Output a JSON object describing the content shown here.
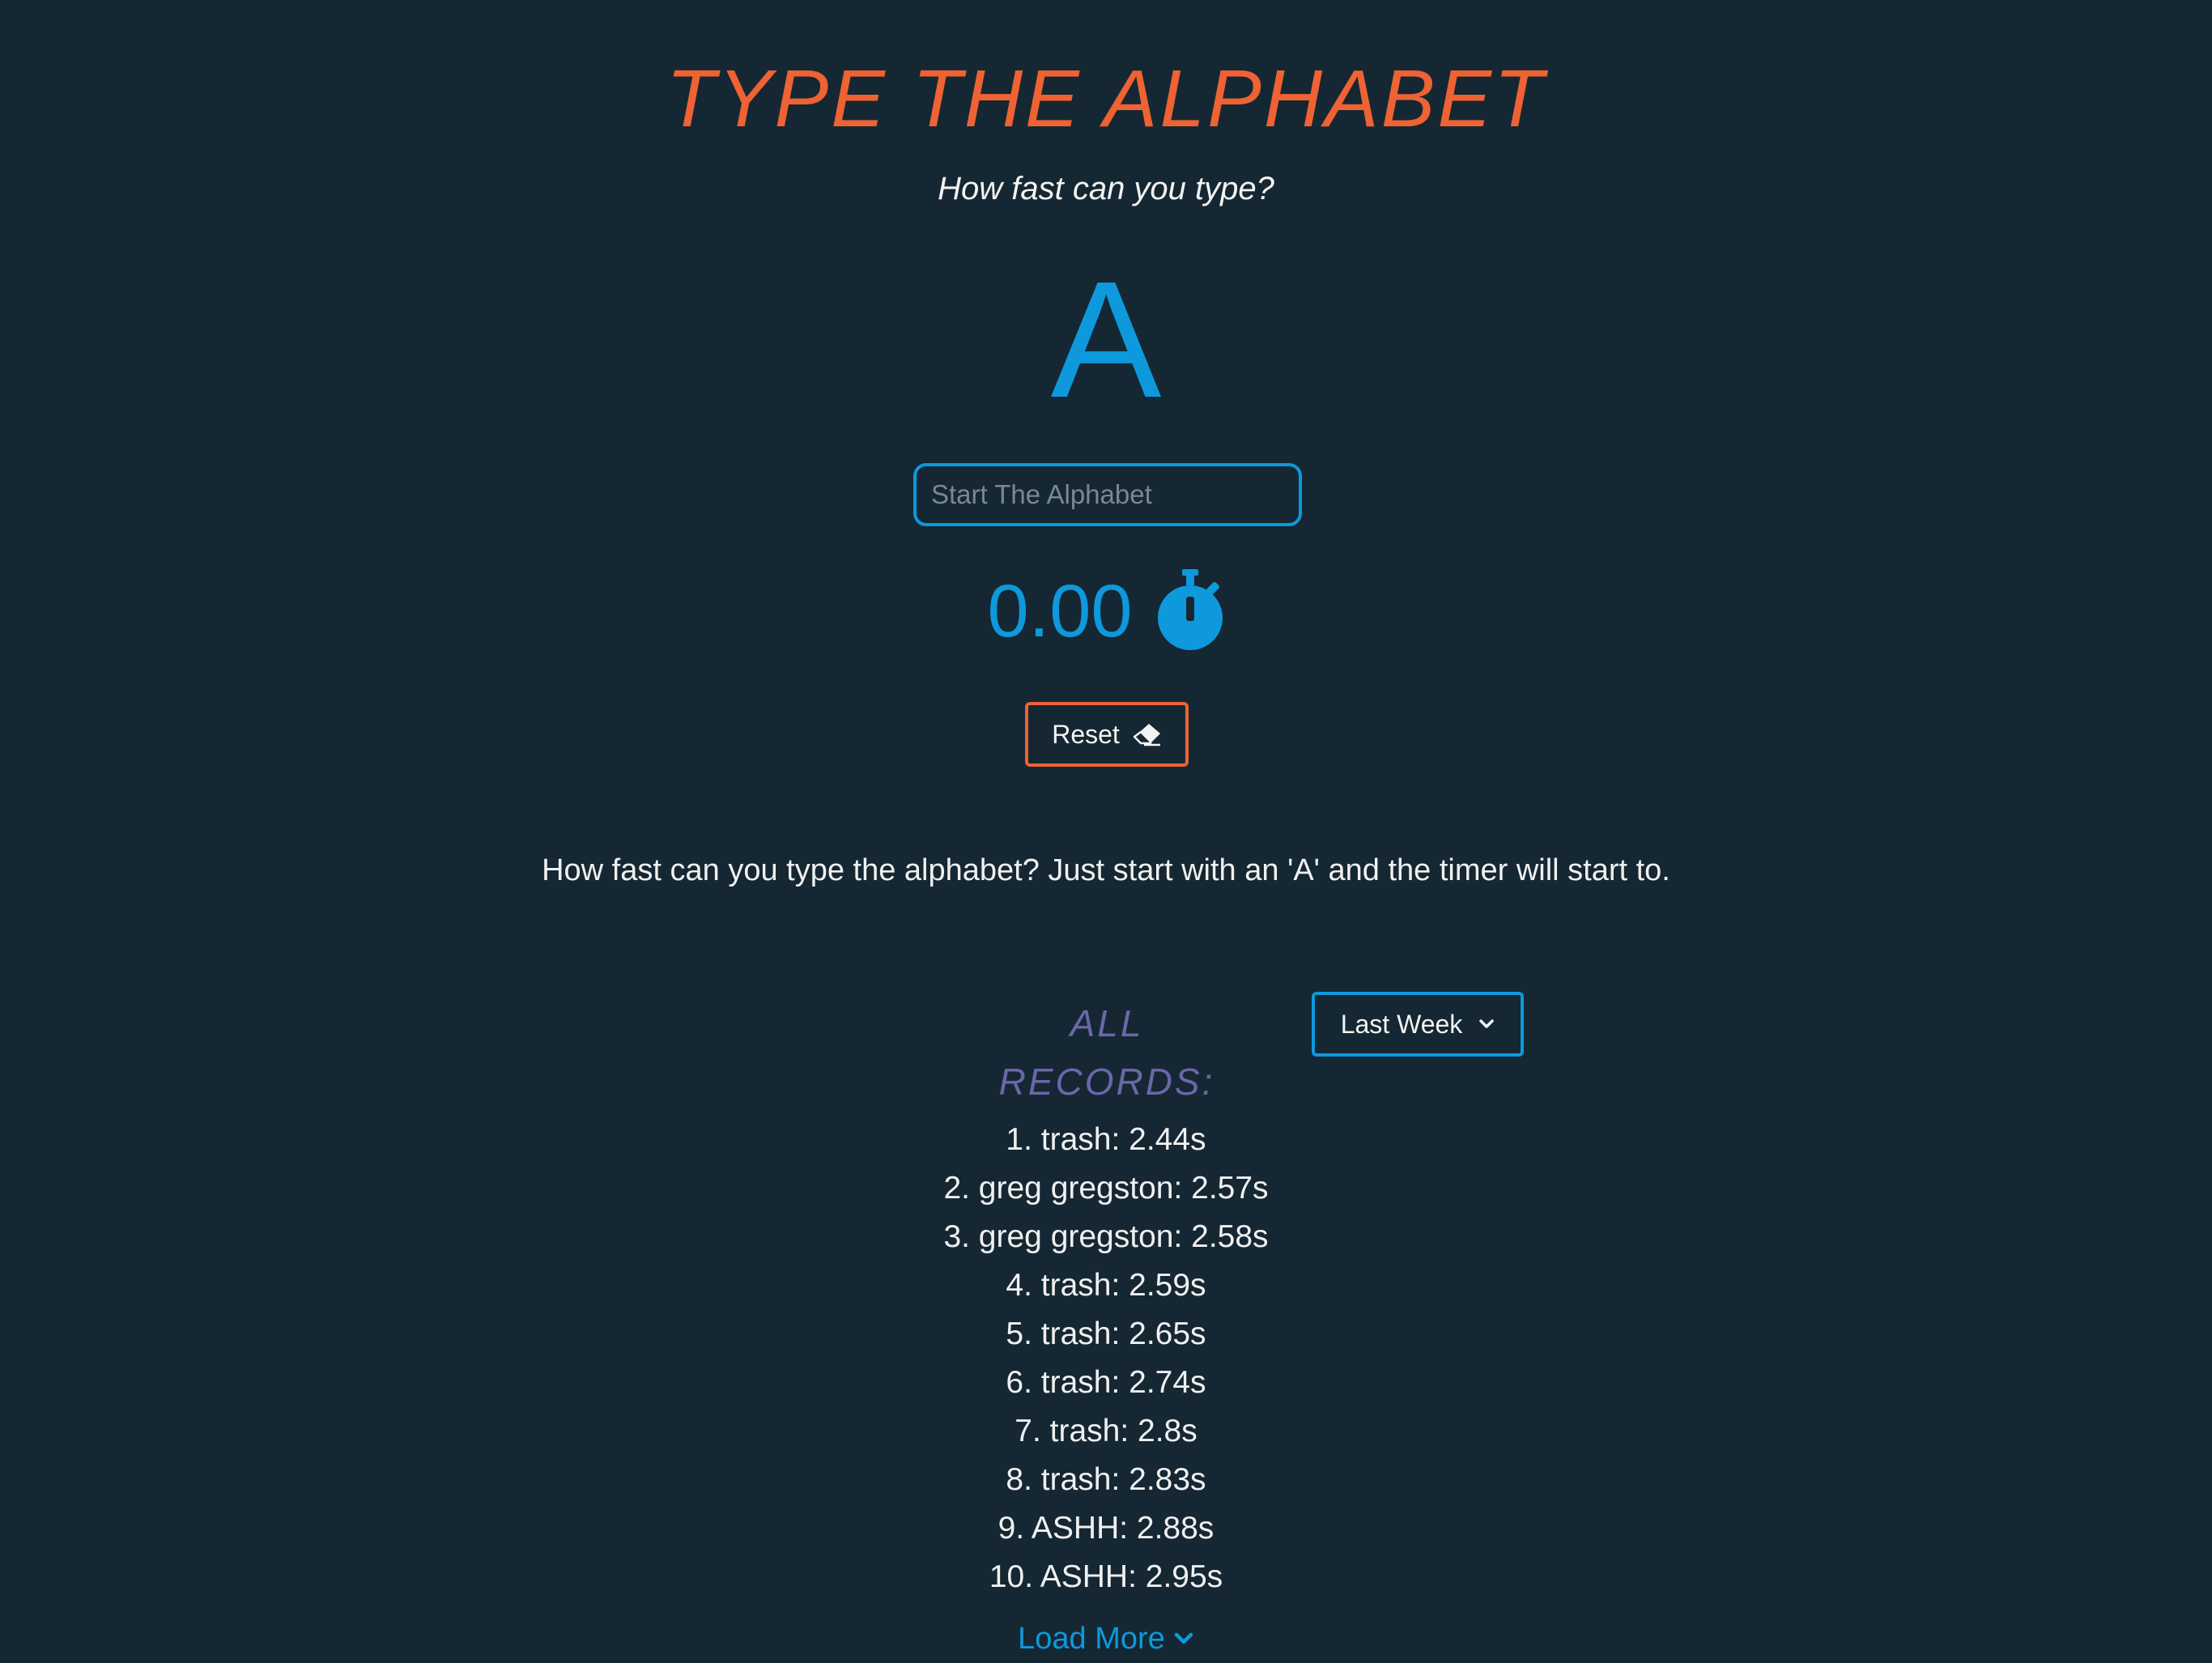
{
  "header": {
    "title": "TYPE THE ALPHABET",
    "subtitle": "How fast can you type?"
  },
  "game": {
    "current_letter": "A",
    "input_placeholder": "Start The Alphabet",
    "input_value": "",
    "timer_value": "0.00",
    "timer_icon": "stopwatch-icon",
    "reset_label": "Reset",
    "reset_icon": "eraser-icon"
  },
  "description": "How fast can you type the alphabet? Just start with an 'A' and the timer will start to.",
  "records": {
    "title_line1": "ALL",
    "title_line2": "RECORDS:",
    "filter_selected": "Last Week",
    "items": [
      "1. trash: 2.44s",
      "2. greg gregston: 2.57s",
      "3. greg gregston: 2.58s",
      "4. trash: 2.59s",
      "5. trash: 2.65s",
      "6. trash: 2.74s",
      "7. trash: 2.8s",
      "8. trash: 2.83s",
      "9. ASHH: 2.88s",
      "10. ASHH: 2.95s"
    ],
    "load_more_label": "Load More"
  },
  "colors": {
    "background": "#152733",
    "accent_orange": "#ee6233",
    "accent_blue": "#0d99db",
    "records_title": "#6a67a8"
  }
}
